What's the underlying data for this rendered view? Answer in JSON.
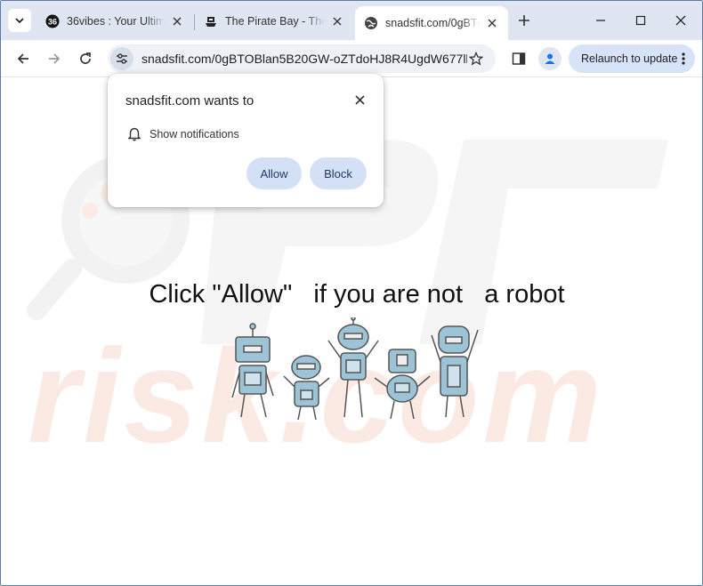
{
  "tabs": [
    {
      "title": "36vibes : Your Ultimate",
      "favicon": "36vibes-logo-icon"
    },
    {
      "title": "The Pirate Bay - The galaxy",
      "favicon": "pirate-ship-icon"
    },
    {
      "title": "snadsfit.com/0gBTOBlan5",
      "favicon": "globe-icon",
      "active": true
    }
  ],
  "toolbar": {
    "url": "snadsfit.com/0gBTOBlan5B20GW-oZTdoHJ8R4UgdW677lhv...",
    "relaunch_label": "Relaunch to update"
  },
  "popup": {
    "title": "snadsfit.com wants to",
    "permission": "Show notifications",
    "allow_label": "Allow",
    "block_label": "Block"
  },
  "page": {
    "headline": "Click \"Allow\"   if you are not   a robot"
  },
  "colors": {
    "tabstrip_bg": "#dfe6f1",
    "omnibox_bg": "#eef1f6",
    "button_bg": "#d3e0f5",
    "robot_blue": "#9cc3d6"
  }
}
